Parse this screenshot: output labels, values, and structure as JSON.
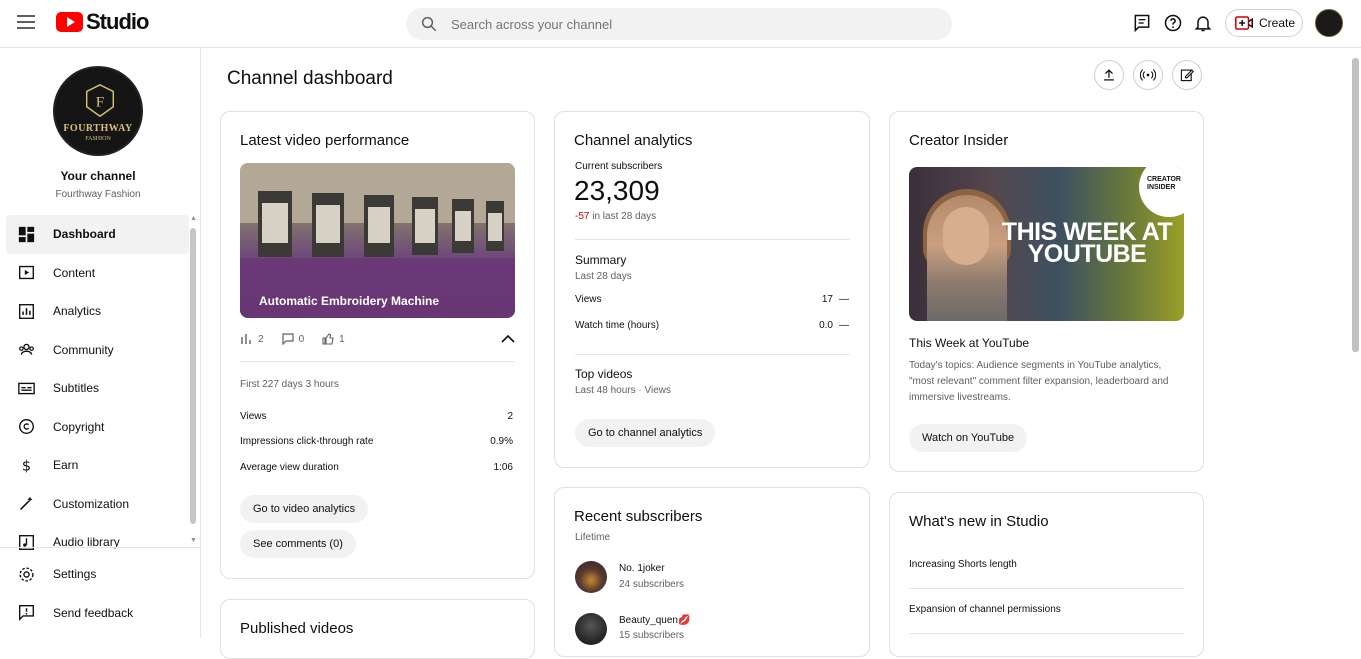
{
  "topbar": {
    "logo_text": "Studio",
    "search_placeholder": "Search across your channel",
    "create_label": "Create"
  },
  "sidebar": {
    "channel_name_logo": "FOURTHWAY",
    "channel_logo_sub": "FASHION",
    "channel_title": "Your channel",
    "channel_name": "Fourthway Fashion",
    "items": [
      {
        "label": "Dashboard",
        "icon": "dashboard-icon"
      },
      {
        "label": "Content",
        "icon": "content-icon"
      },
      {
        "label": "Analytics",
        "icon": "analytics-icon"
      },
      {
        "label": "Community",
        "icon": "community-icon"
      },
      {
        "label": "Subtitles",
        "icon": "subtitles-icon"
      },
      {
        "label": "Copyright",
        "icon": "copyright-icon"
      },
      {
        "label": "Earn",
        "icon": "earn-icon"
      },
      {
        "label": "Customization",
        "icon": "customization-icon"
      },
      {
        "label": "Audio library",
        "icon": "audio-library-icon"
      }
    ],
    "bottom": [
      {
        "label": "Settings",
        "icon": "settings-icon"
      },
      {
        "label": "Send feedback",
        "icon": "feedback-icon"
      }
    ]
  },
  "main": {
    "title": "Channel dashboard",
    "latest": {
      "heading": "Latest video performance",
      "video_title": "Automatic Embroidery Machine",
      "views_count": "2",
      "comments_count": "0",
      "likes_count": "1",
      "period": "First 227 days 3 hours",
      "rows": [
        {
          "label": "Views",
          "value": "2"
        },
        {
          "label": "Impressions click-through rate",
          "value": "0.9%"
        },
        {
          "label": "Average view duration",
          "value": "1:06"
        }
      ],
      "btn_analytics": "Go to video analytics",
      "btn_comments": "See comments (0)"
    },
    "published": {
      "heading": "Published videos"
    },
    "analytics": {
      "heading": "Channel analytics",
      "current_label": "Current subscribers",
      "current_value": "23,309",
      "delta": "-57",
      "delta_suffix": " in last 28 days",
      "summary_title": "Summary",
      "summary_period": "Last 28 days",
      "rows": [
        {
          "label": "Views",
          "value": "17",
          "trend": "—"
        },
        {
          "label": "Watch time (hours)",
          "value": "0.0",
          "trend": "—"
        }
      ],
      "top_title": "Top videos",
      "top_period": "Last 48 hours · Views",
      "btn": "Go to channel analytics"
    },
    "recent": {
      "heading": "Recent subscribers",
      "period": "Lifetime",
      "subs": [
        {
          "name": "No. 1joker",
          "count": "24 subscribers"
        },
        {
          "name": "Beauty_quen💋",
          "count": "15 subscribers"
        }
      ]
    },
    "insider": {
      "heading": "Creator Insider",
      "badge": "CREATOR INSIDER",
      "thumb_text": "THIS WEEK AT YOUTUBE",
      "video_title": "This Week at YouTube",
      "desc": "Today's topics: Audience segments in YouTube analytics, \"most relevant\" comment filter expansion, leaderboard and immersive livestreams.",
      "btn": "Watch on YouTube"
    },
    "whatsnew": {
      "heading": "What's new in Studio",
      "items": [
        "Increasing Shorts length",
        "Expansion of channel permissions"
      ]
    }
  }
}
